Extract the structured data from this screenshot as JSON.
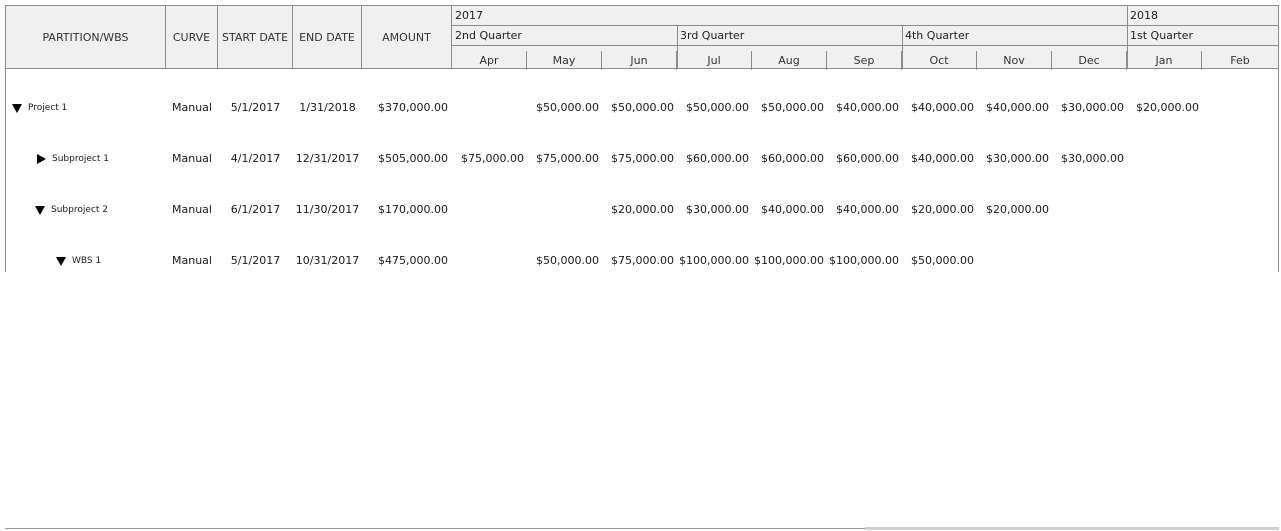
{
  "columns": {
    "partition": "PARTITION/WBS",
    "curve": "CURVE",
    "start_date": "START DATE",
    "end_date": "END DATE",
    "amount": "AMOUNT"
  },
  "timeline": {
    "years": [
      "2017",
      "2018"
    ],
    "quarters": [
      "2nd Quarter",
      "3rd Quarter",
      "4th Quarter",
      "1st Quarter"
    ],
    "months": [
      "Apr",
      "May",
      "Jun",
      "Jul",
      "Aug",
      "Sep",
      "Oct",
      "Nov",
      "Dec",
      "Jan",
      "Feb"
    ]
  },
  "rows": [
    {
      "name": "Project 1",
      "expanded": true,
      "curve": "Manual",
      "start": "5/1/2017",
      "end": "1/31/2018",
      "amount": "$370,000.00",
      "months": [
        "",
        "$50,000.00",
        "$50,000.00",
        "$50,000.00",
        "$50,000.00",
        "$40,000.00",
        "$40,000.00",
        "$40,000.00",
        "$30,000.00",
        "$20,000.00",
        ""
      ]
    },
    {
      "name": "Subproject 1",
      "expanded": false,
      "curve": "Manual",
      "start": "4/1/2017",
      "end": "12/31/2017",
      "amount": "$505,000.00",
      "months": [
        "$75,000.00",
        "$75,000.00",
        "$75,000.00",
        "$60,000.00",
        "$60,000.00",
        "$60,000.00",
        "$40,000.00",
        "$30,000.00",
        "$30,000.00",
        "",
        ""
      ]
    },
    {
      "name": "Subproject 2",
      "expanded": true,
      "curve": "Manual",
      "start": "6/1/2017",
      "end": "11/30/2017",
      "amount": "$170,000.00",
      "months": [
        "",
        "",
        "$20,000.00",
        "$30,000.00",
        "$40,000.00",
        "$40,000.00",
        "$20,000.00",
        "$20,000.00",
        "",
        "",
        ""
      ]
    },
    {
      "name": "WBS 1",
      "expanded": true,
      "curve": "Manual",
      "start": "5/1/2017",
      "end": "10/31/2017",
      "amount": "$475,000.00",
      "months": [
        "",
        "$50,000.00",
        "$75,000.00",
        "$100,000.00",
        "$100,000.00",
        "$100,000.00",
        "$50,000.00",
        "",
        "",
        "",
        ""
      ]
    }
  ]
}
